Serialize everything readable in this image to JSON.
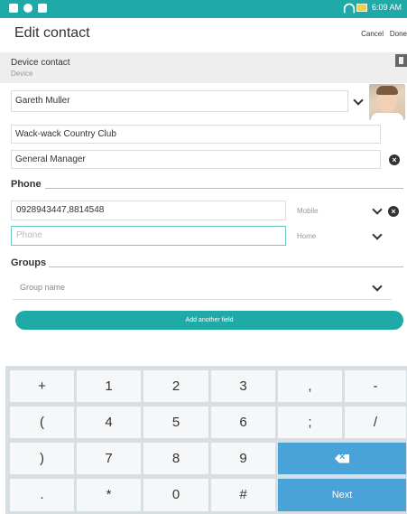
{
  "status_bar": {
    "time": "6:09 AM"
  },
  "header": {
    "title": "Edit contact",
    "cancel_label": "Cancel",
    "done_label": "Done"
  },
  "account": {
    "name": "Device contact",
    "type": "Device"
  },
  "contact": {
    "name": "Gareth Muller",
    "company": "Wack-wack Country Club",
    "job_title": "General Manager"
  },
  "phone_section": {
    "heading": "Phone",
    "entries": [
      {
        "value": "0928943447,8814548",
        "type": "Mobile"
      },
      {
        "value": "",
        "placeholder": "Phone",
        "type": "Home"
      }
    ]
  },
  "groups_section": {
    "heading": "Groups",
    "placeholder": "Group name"
  },
  "add_field_label": "Add another field",
  "keyboard": {
    "rows": [
      [
        "+",
        "1",
        "2",
        "3",
        ",",
        "-"
      ],
      [
        "(",
        "4",
        "5",
        "6",
        ";",
        "/"
      ],
      [
        ")",
        "7",
        "8",
        "9"
      ],
      [
        ".",
        "*",
        "0",
        "#"
      ]
    ],
    "next_label": "Next",
    "accent_color": "#4aa3d8"
  },
  "colors": {
    "teal_accent": "#1fa9a7"
  }
}
